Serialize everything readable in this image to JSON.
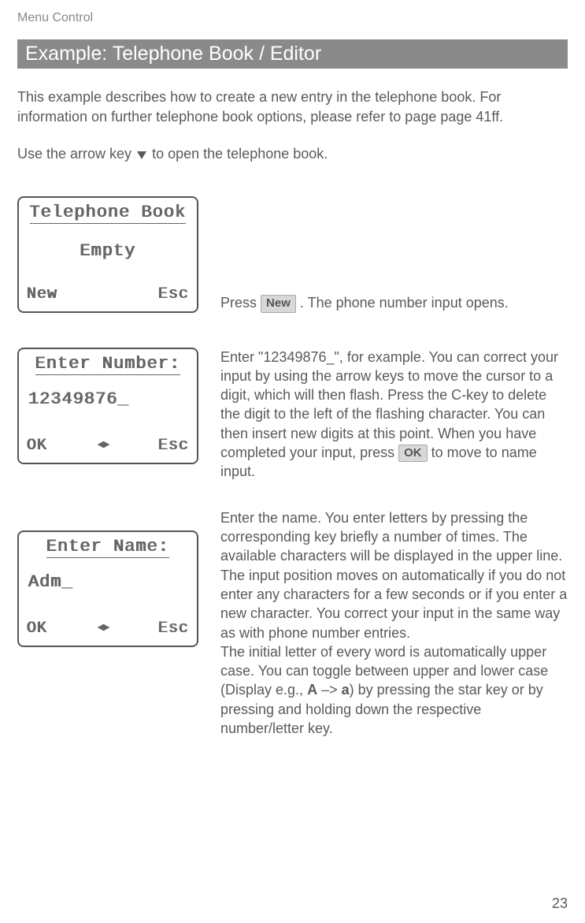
{
  "runningHeader": "Menu Control",
  "heading": "Example: Telephone Book / Editor",
  "intro": "This example describes how to create a new entry in the telephone book. For information on further telephone book options, please refer to page page 41ff.",
  "instruction_pre": "Use the arrow key",
  "instruction_post": "to open the telephone book.",
  "screens": {
    "s1": {
      "title": "Telephone Book",
      "body": "Empty",
      "left": "New",
      "right": "Esc"
    },
    "s2": {
      "title": "Enter Number:",
      "body": "12349876_",
      "left": "OK",
      "right": "Esc"
    },
    "s3": {
      "title": "Enter Name:",
      "body": "Adm_",
      "left": "OK",
      "right": "Esc"
    }
  },
  "desc1_pre": "Press",
  "desc1_btn": "New",
  "desc1_post": ". The phone number input opens.",
  "desc2_a": "Enter \"12349876_\", for example. You can correct your input by using the arrow keys to move the cursor to a digit, which will then flash. Press the C-key to delete the digit to the left of the flashing character. You can then insert new digits at this point. When you have completed your input, press",
  "desc2_btn": "OK",
  "desc2_b": "to move to name input.",
  "desc3_a": "Enter the name. You enter letters by pressing the corresponding key briefly a number of times. The available characters will be displayed in the upper line. The input position moves on automatically if you do not enter any characters for a few seconds or if you enter a new character. You correct your input in the same way as with phone number entries.",
  "desc3_b": "The initial letter of every word is automatically upper case. You can toggle between upper and lower case (Display e.g.,",
  "desc3_boldA": "A",
  "desc3_arrow": "–>",
  "desc3_bolda": "a",
  "desc3_c": ") by pressing the star key or by pressing and holding down the respective number/letter key.",
  "pageNumber": "23"
}
